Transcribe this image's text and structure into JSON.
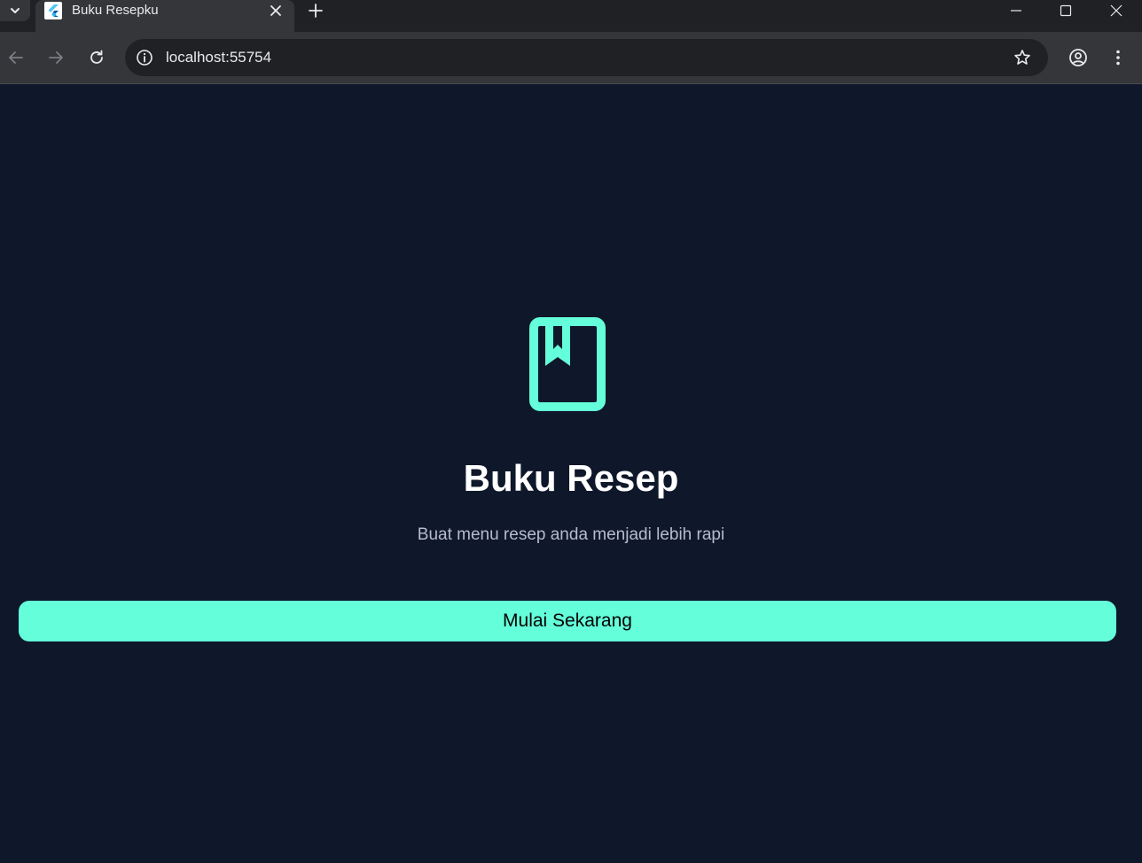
{
  "browser": {
    "tab": {
      "title": "Buku Resepku",
      "favicon_icon": "flutter-icon"
    },
    "url": "localhost:55754",
    "icons": {
      "tab_search": "chevron-down-icon",
      "tab_close": "close-icon",
      "new_tab": "plus-icon",
      "minimize": "minimize-icon",
      "maximize": "maximize-icon",
      "close_window": "close-icon",
      "back": "arrow-left-icon",
      "forward": "arrow-right-icon",
      "reload": "reload-icon",
      "site_info": "info-icon",
      "bookmark": "star-icon",
      "profile": "account-circle-icon",
      "menu": "more-vert-icon"
    }
  },
  "app": {
    "logo_icon": "bookmark-book-icon",
    "title": "Buku Resep",
    "subtitle": "Buat menu resep anda menjadi lebih rapi",
    "cta_label": "Mulai Sekarang"
  },
  "colors": {
    "background": "#0f172a",
    "accent": "#64ffda",
    "title_text": "#ffffff",
    "subtitle_text": "#b6bccb",
    "cta_text": "#000000"
  }
}
